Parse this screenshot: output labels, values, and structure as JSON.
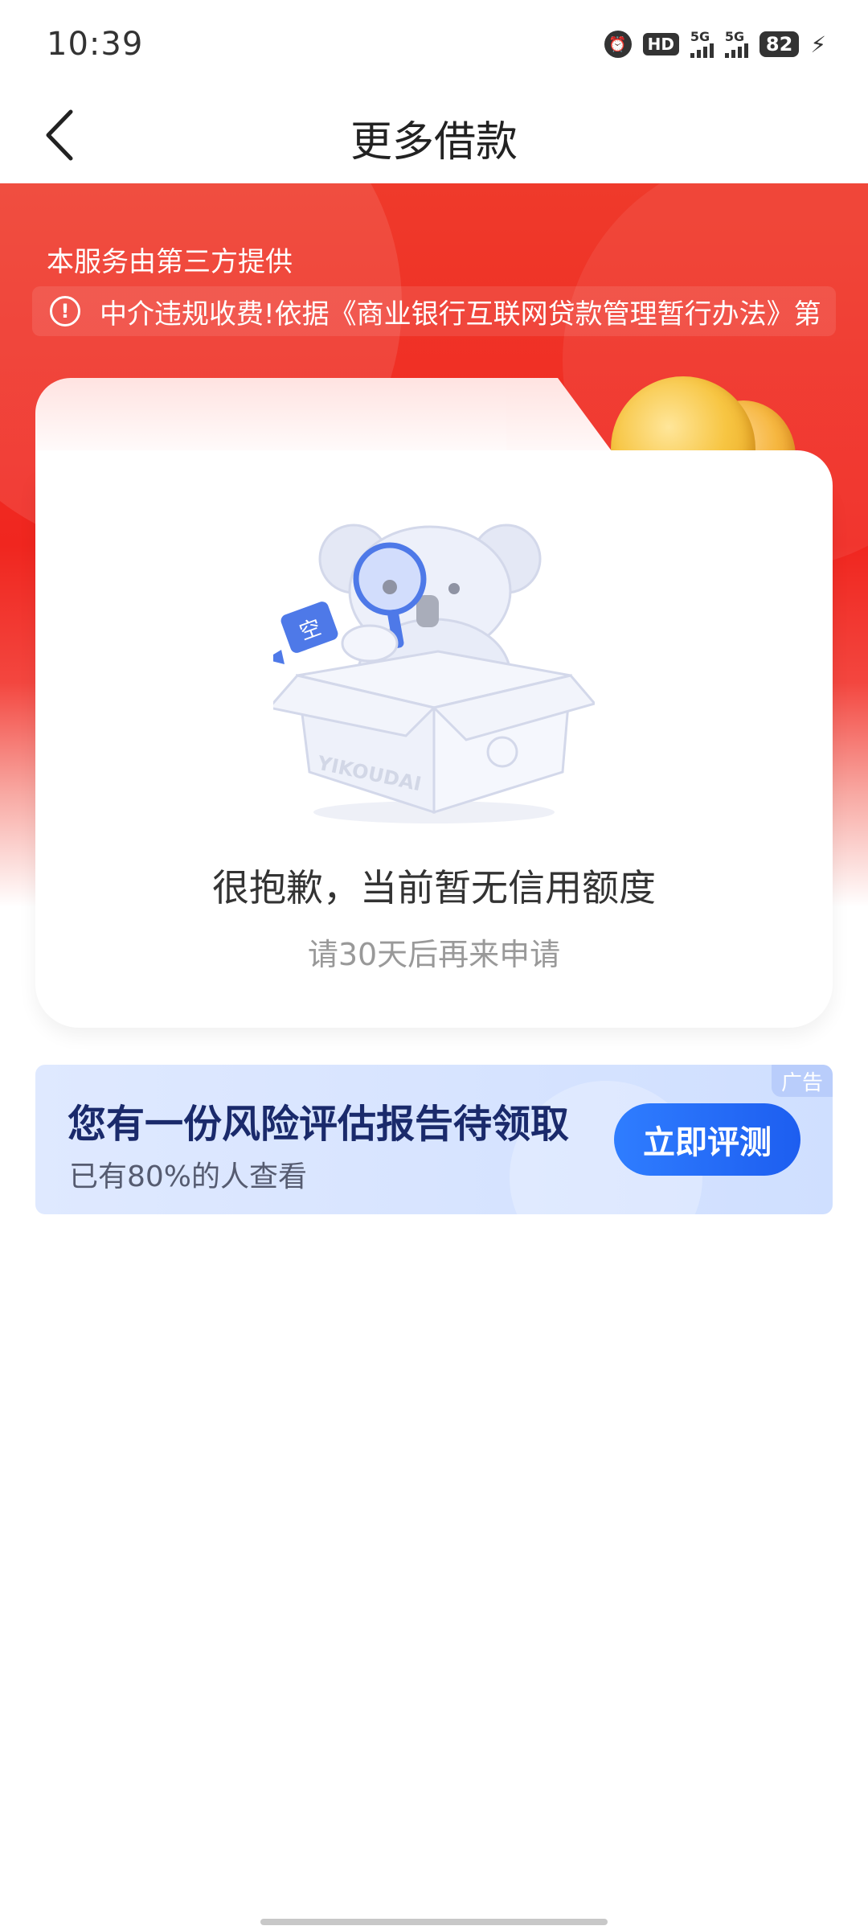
{
  "status_bar": {
    "time": "10:39",
    "hd_label": "HD",
    "signal1_label": "5G",
    "signal2_label": "5G",
    "battery": "82",
    "icons": [
      "alarm-icon",
      "hd-icon",
      "signal-5g-icon",
      "signal-5g-icon",
      "battery-icon",
      "charging-icon"
    ]
  },
  "nav": {
    "title": "更多借款",
    "back_icon": "chevron-left-icon"
  },
  "hero": {
    "provider_text": "本服务由第三方提供",
    "notice_icon": "alert-circle-icon",
    "notice_text": "中介违规收费!依据《商业银行互联网贷款管理暂行办法》第"
  },
  "empty_state": {
    "illustration_icon": "koala-in-box-icon",
    "illustration_box_text": "YIKOUDAI",
    "illustration_bubble_text": "空",
    "title": "很抱歉，当前暂无信用额度",
    "subtitle": "请30天后再来申请"
  },
  "ad": {
    "title": "您有一份风险评估报告待领取",
    "subtitle": "已有80%的人查看",
    "button_label": "立即评测",
    "badge": "广告"
  },
  "colors": {
    "hero_red": "#f0261f",
    "ad_button": "#1d5ef0",
    "ad_bg": "#d6e3ff"
  }
}
